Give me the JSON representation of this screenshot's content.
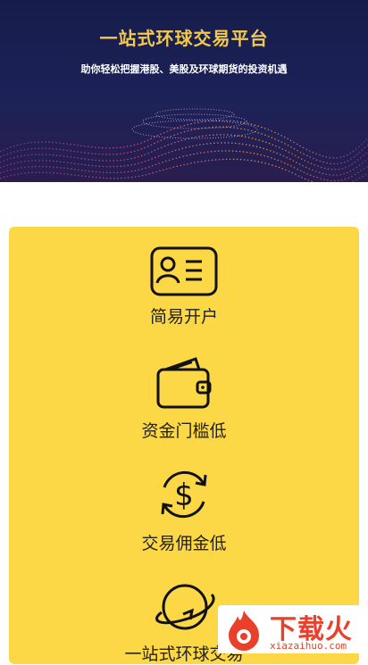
{
  "hero": {
    "title": "一站式环球交易平台",
    "subtitle": "助你轻松把握港股、美股及环球期货的投资机遇"
  },
  "features": [
    {
      "label": "简易开户",
      "icon": "id-card-icon"
    },
    {
      "label": "资金门槛低",
      "icon": "wallet-icon"
    },
    {
      "label": "交易佣金低",
      "icon": "dollar-cycle-icon"
    },
    {
      "label": "一站式环球交易",
      "icon": "planet-icon"
    }
  ],
  "watermark": {
    "brand": "下载火",
    "domain": "xiazaihuo.com"
  },
  "colors": {
    "hero_bg": "#161c4a",
    "hero_title": "#f2c94c",
    "card_bg": "#fcd846",
    "icon_stroke": "#111111",
    "watermark": "#e8402a"
  }
}
